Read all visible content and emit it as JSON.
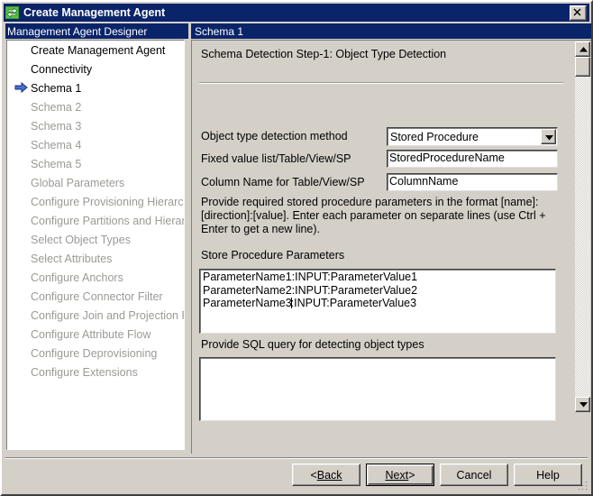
{
  "window": {
    "title": "Create Management Agent",
    "icon": "management-agent-icon",
    "close_label": "X"
  },
  "left_pane": {
    "header": "Management Agent Designer",
    "items": [
      {
        "label": "Create Management Agent",
        "state": "done",
        "marker": ""
      },
      {
        "label": "Connectivity",
        "state": "done",
        "marker": ""
      },
      {
        "label": "Schema 1",
        "state": "current",
        "marker": "arrow-right-icon"
      },
      {
        "label": "Schema 2",
        "state": "disabled",
        "marker": ""
      },
      {
        "label": "Schema 3",
        "state": "disabled",
        "marker": ""
      },
      {
        "label": "Schema 4",
        "state": "disabled",
        "marker": ""
      },
      {
        "label": "Schema 5",
        "state": "disabled",
        "marker": ""
      },
      {
        "label": "Global Parameters",
        "state": "disabled",
        "marker": ""
      },
      {
        "label": "Configure Provisioning Hierarchy",
        "state": "disabled",
        "marker": ""
      },
      {
        "label": "Configure Partitions and Hierarchies",
        "state": "disabled",
        "marker": ""
      },
      {
        "label": "Select Object Types",
        "state": "disabled",
        "marker": ""
      },
      {
        "label": "Select Attributes",
        "state": "disabled",
        "marker": ""
      },
      {
        "label": "Configure Anchors",
        "state": "disabled",
        "marker": ""
      },
      {
        "label": "Configure Connector Filter",
        "state": "disabled",
        "marker": ""
      },
      {
        "label": "Configure Join and Projection Rules",
        "state": "disabled",
        "marker": ""
      },
      {
        "label": "Configure Attribute Flow",
        "state": "disabled",
        "marker": ""
      },
      {
        "label": "Configure Deprovisioning",
        "state": "disabled",
        "marker": ""
      },
      {
        "label": "Configure Extensions",
        "state": "disabled",
        "marker": ""
      }
    ]
  },
  "right_pane": {
    "header": "Schema 1",
    "step_title": "Schema Detection Step-1:  Object Type Detection",
    "fields": {
      "detection_method": {
        "label": "Object type detection method",
        "value": "Stored Procedure"
      },
      "fixed_value_list": {
        "label": "Fixed value list/Table/View/SP",
        "value": "StoredProcedureName"
      },
      "column_name": {
        "label": "Column Name for Table/View/SP",
        "value": "ColumnName"
      }
    },
    "instructions": "Provide required stored procedure parameters in the format [name]:[direction]:[value]. Enter each parameter on separate lines (use Ctrl + Enter to get a new line).",
    "params_label": "Store Procedure Parameters",
    "params_value_before_caret": "ParameterName1:INPUT:ParameterValue1\nParameterName2:INPUT:ParameterValue2\nParameterName3",
    "params_value_after_caret": ":INPUT:ParameterValue3",
    "sql_label": "Provide SQL query for detecting object types",
    "sql_value": ""
  },
  "buttons": {
    "back": "Back",
    "back_prefix": "< ",
    "next": "Next",
    "next_suffix": " >",
    "cancel": "Cancel",
    "help": "Help"
  },
  "colors": {
    "face": "#d4d0c8",
    "titlebar": "#0a246a",
    "title_text": "#ffffff",
    "disabled_text": "#9a9a96",
    "text": "#000000",
    "field_bg": "#ffffff",
    "accent_arrow": "#2b4ea8"
  }
}
